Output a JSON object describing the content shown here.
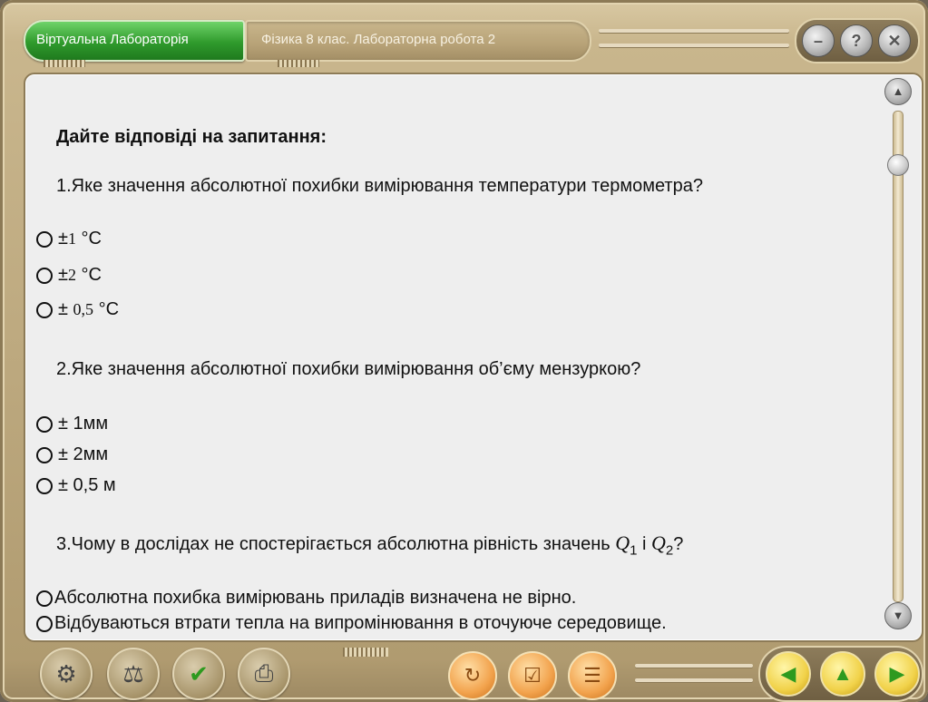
{
  "header": {
    "tab_active": "Віртуальна Лабораторія",
    "tab_title": "Фізика 8 клас. Лабораторна робота 2",
    "window_buttons": [
      "minimize-icon",
      "help-icon",
      "close-icon"
    ]
  },
  "content": {
    "heading": "Дайте відповіді на запитання:",
    "q1": {
      "text": "1.Яке значення абсолютної похибки вимірювання температури термометра?",
      "options": [
        {
          "pm": "±",
          "num": "1",
          "unit": "°С"
        },
        {
          "pm": "±",
          "num": "2",
          "unit": "°С"
        },
        {
          "pm": "±",
          "num": "0,5",
          "unit": "°С"
        }
      ]
    },
    "q2": {
      "text": "2.Яке значення абсолютної похибки вимірювання об’єму мензуркою?",
      "options": [
        "± 1мм",
        "± 2мм",
        "± 0,5 м"
      ]
    },
    "q3": {
      "text": "3.Чому в дослідах не спостерігається абсолютна рівність значень",
      "sym1": "Q",
      "sub1": "1",
      "conj": "і",
      "sym2": "Q",
      "sub2": "2",
      "qmark": "?",
      "options": [
        "Абсолютна похибка вимірювань приладів визначена не вірно.",
        "Відбуваються втрати тепла на випромінювання в оточуюче середовище."
      ]
    }
  },
  "toolbar": {
    "tools": [
      "gears-icon",
      "weights-icon",
      "checklist-icon",
      "printer-icon"
    ],
    "actions": [
      "reset-icon",
      "check-answers-icon",
      "report-icon"
    ],
    "nav": [
      "arrow-left-icon",
      "arrow-up-icon",
      "arrow-right-icon"
    ]
  },
  "colors": {
    "accent_green": "#2f9a2c",
    "panel_bg": "#eeeeee",
    "frame": "#bda97f"
  }
}
